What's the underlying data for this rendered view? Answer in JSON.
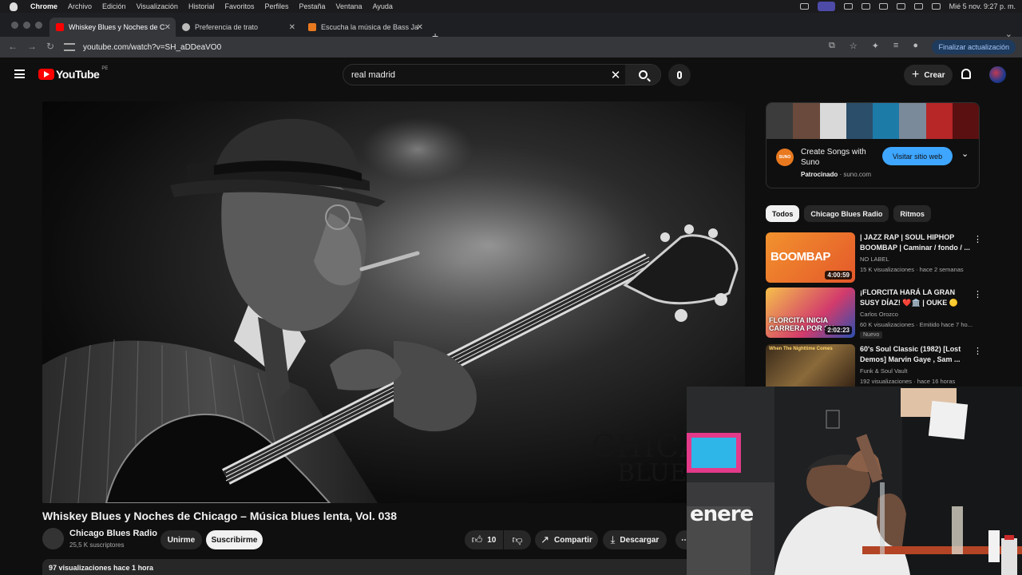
{
  "mac_menu": {
    "items": [
      "Chrome",
      "Archivo",
      "Edición",
      "Visualización",
      "Historial",
      "Favoritos",
      "Perfiles",
      "Pestaña",
      "Ventana",
      "Ayuda"
    ],
    "clock": "Mié 5 nov.  9:27 p. m."
  },
  "tabs": [
    {
      "title": "Whiskey Blues y Noches de C",
      "favicon_color": "#ff0000"
    },
    {
      "title": "Preferencia de trato",
      "favicon_color": "#bbbbbb"
    },
    {
      "title": "Escucha la música de Bass Ja",
      "favicon_color": "#e9791f"
    }
  ],
  "address": {
    "url": "youtube.com/watch?v=SH_aDDeaVO0",
    "update_label": "Finalizar actualización"
  },
  "youtube": {
    "logo": "YouTube",
    "country": "PE",
    "search_value": "real madrid",
    "create_label": "Crear"
  },
  "video": {
    "title": "Whiskey Blues y Noches de Chicago – Música blues lenta, Vol. 038",
    "watermark_line1": "CHICAGO",
    "watermark_line2": "BLUES",
    "channel": "Chicago Blues Radio",
    "subscribers": "25,5 K suscriptores",
    "join_label": "Unirme",
    "subscribe_label": "Suscribirme",
    "likes": "10",
    "share_label": "Compartir",
    "download_label": "Descargar",
    "views_line": "97 visualizaciones  hace 1 hora"
  },
  "ad": {
    "headline": "Create Songs with Suno",
    "sponsored": "Patrocinado",
    "domain": "suno.com",
    "cta": "Visitar sitio web",
    "logo_text": "SUNO"
  },
  "chips": [
    "Todos",
    "Chicago Blues Radio",
    "Ritmos"
  ],
  "related": [
    {
      "title": "| JAZZ RAP | SOUL HIPHOP BOOMBAP | Caminar / fondo / ...",
      "channel": "NO LABEL",
      "meta": "15 K visualizaciones · hace 2 semanas",
      "duration": "4:00:59",
      "thumb_text": "BOOMBAP"
    },
    {
      "title": "¡FLORCITA HARÁ LA GRAN SUSY DÍAZ! ❤️🏛️ | OUKE 🟡",
      "channel": "Carlos Orozco",
      "meta": "60 K visualizaciones · Emitido hace 7 ho...",
      "duration": "2:02:23",
      "badge": "Nuevo",
      "thumb_text": "FLORCITA INICIA CARRERA POR SU..."
    },
    {
      "title": "60's Soul Classic (1982) [Lost Demos] Marvin Gaye , Sam ...",
      "channel": "Funk & Soul Vault",
      "meta": "192 visualizaciones · hace 16 horas",
      "duration": "",
      "thumb_text": "When The Nighttime Comes"
    }
  ],
  "webcam": {
    "sticker_text": "enere"
  }
}
